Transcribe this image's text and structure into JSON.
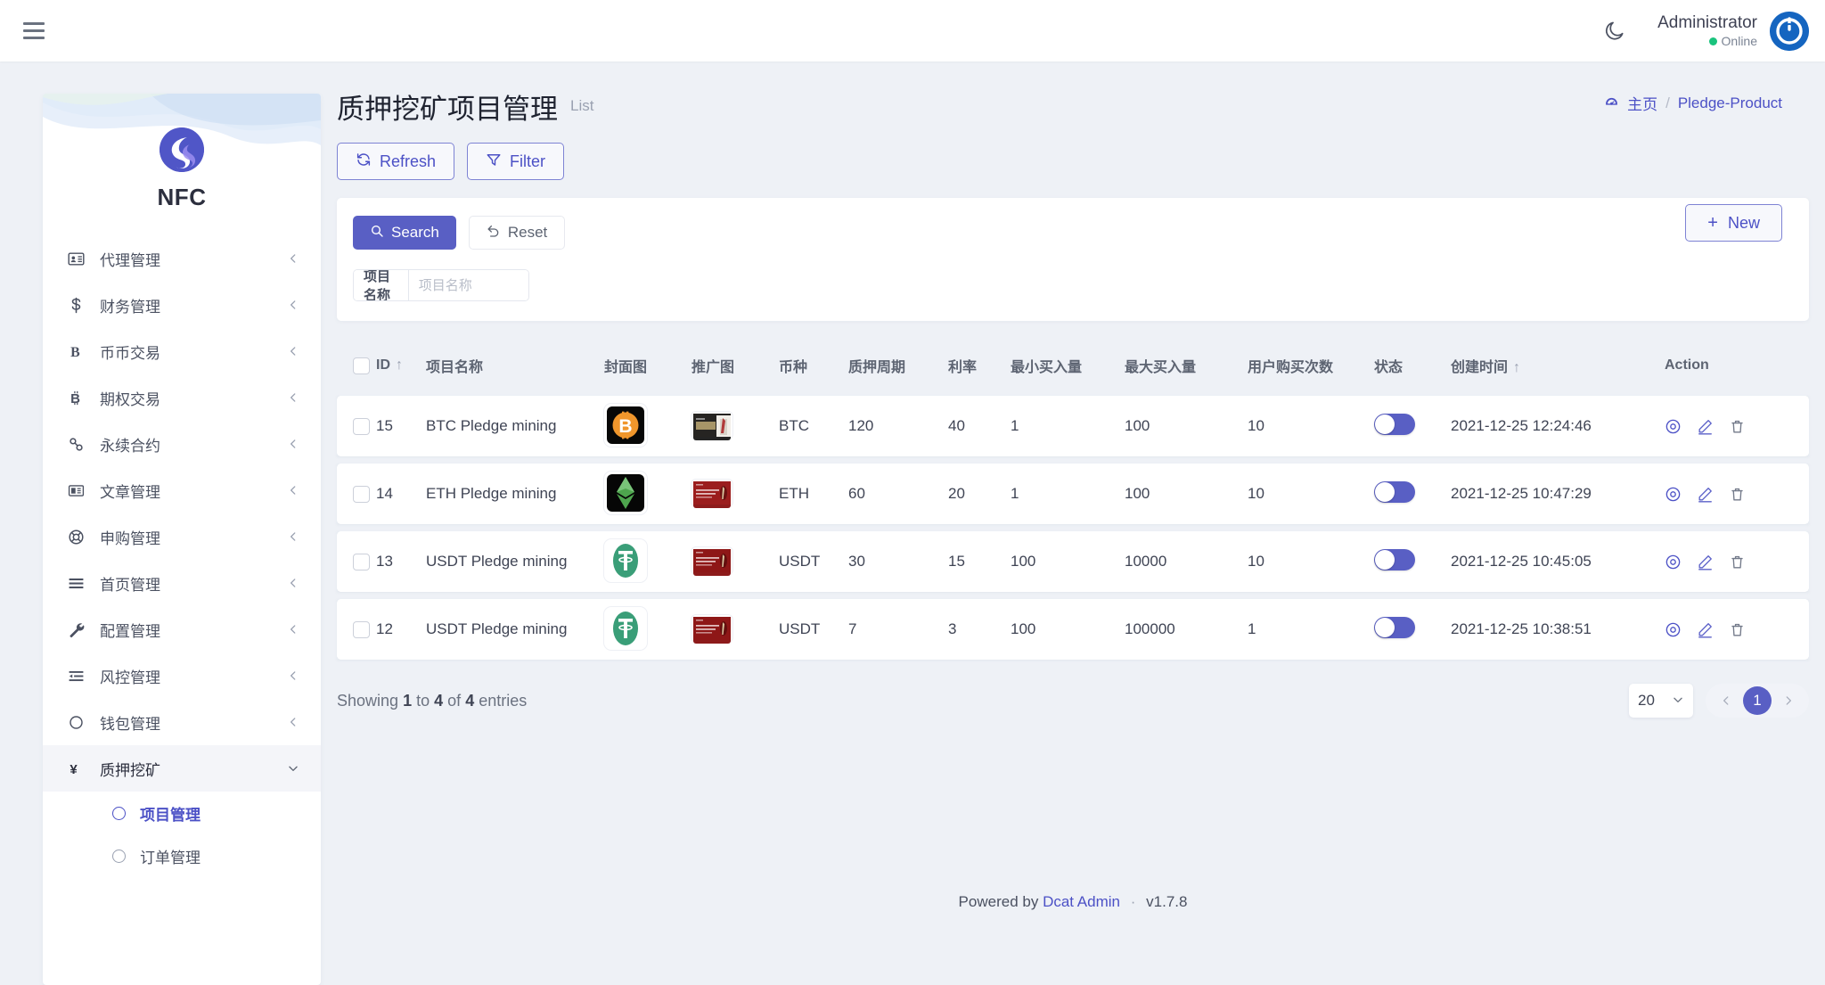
{
  "colors": {
    "accent": "#4c51c6",
    "primary": "#595fc4",
    "page_bg": "#eef1f6",
    "online": "#19c37d",
    "avatar_bg": "#1565c0"
  },
  "topbar": {
    "menu_icon": "hamburger-icon",
    "theme_icon": "moon-icon",
    "user_name": "Administrator",
    "user_status": "Online",
    "avatar_icon": "user-avatar"
  },
  "sidebar": {
    "brand": "NFC",
    "items": [
      {
        "label": "代理管理",
        "icon": "contact-card-icon",
        "arrow": "chevron-left-icon"
      },
      {
        "label": "财务管理",
        "icon": "dollar-icon",
        "arrow": "chevron-left-icon"
      },
      {
        "label": "币币交易",
        "icon": "letter-b-icon",
        "arrow": "chevron-left-icon"
      },
      {
        "label": "期权交易",
        "icon": "bitcoin-icon",
        "arrow": "chevron-left-icon"
      },
      {
        "label": "永续合约",
        "icon": "link-chain-icon",
        "arrow": "chevron-left-icon"
      },
      {
        "label": "文章管理",
        "icon": "newspaper-icon",
        "arrow": "chevron-left-icon"
      },
      {
        "label": "申购管理",
        "icon": "lifebuoy-icon",
        "arrow": "chevron-left-icon"
      },
      {
        "label": "首页管理",
        "icon": "lines-icon",
        "arrow": "chevron-left-icon"
      },
      {
        "label": "配置管理",
        "icon": "wrench-icon",
        "arrow": "chevron-left-icon"
      },
      {
        "label": "风控管理",
        "icon": "indent-icon",
        "arrow": "chevron-left-icon"
      },
      {
        "label": "钱包管理",
        "icon": "circle-icon",
        "arrow": "chevron-left-icon"
      }
    ],
    "active_group": {
      "label": "质押挖矿",
      "icon": "yen-icon",
      "arrow": "chevron-down-icon"
    },
    "submenu": [
      {
        "label": "项目管理",
        "current": true
      },
      {
        "label": "订单管理",
        "current": false
      }
    ]
  },
  "page": {
    "title": "质押挖矿项目管理",
    "subtitle": "List",
    "breadcrumb": {
      "home_icon": "dashboard-icon",
      "home": "主页",
      "separator": "/",
      "current": "Pledge-Product"
    },
    "toolbar": {
      "refresh_label": "Refresh",
      "refresh_icon": "refresh-icon",
      "filter_label": "Filter",
      "filter_icon": "funnel-icon",
      "new_label": "New",
      "new_icon": "plus-icon"
    }
  },
  "filter": {
    "search_label": "Search",
    "search_icon": "search-icon",
    "reset_label": "Reset",
    "reset_icon": "undo-icon",
    "field_label": "项目名称",
    "field_value": "",
    "field_placeholder": "项目名称"
  },
  "table": {
    "columns": [
      {
        "key": "checkbox",
        "label": "",
        "sort": ""
      },
      {
        "key": "id",
        "label": "ID",
        "sort": "↑"
      },
      {
        "key": "name",
        "label": "项目名称",
        "sort": ""
      },
      {
        "key": "cover",
        "label": "封面图",
        "sort": ""
      },
      {
        "key": "promo",
        "label": "推广图",
        "sort": ""
      },
      {
        "key": "coin",
        "label": "币种",
        "sort": ""
      },
      {
        "key": "period",
        "label": "质押周期",
        "sort": ""
      },
      {
        "key": "rate",
        "label": "利率",
        "sort": ""
      },
      {
        "key": "min_buy",
        "label": "最小买入量",
        "sort": ""
      },
      {
        "key": "max_buy",
        "label": "最大买入量",
        "sort": ""
      },
      {
        "key": "user_times",
        "label": "用户购买次数",
        "sort": ""
      },
      {
        "key": "status",
        "label": "状态",
        "sort": ""
      },
      {
        "key": "created_at",
        "label": "创建时间",
        "sort": "↑"
      },
      {
        "key": "action",
        "label": "Action",
        "sort": ""
      }
    ],
    "rows": [
      {
        "id": "15",
        "name": "BTC Pledge mining",
        "cover_icon": "bitcoin-coin-thumbnail",
        "promo_icon": "dark-bank-card-thumbnail",
        "coin": "BTC",
        "period": "120",
        "rate": "40",
        "min_buy": "1",
        "max_buy": "100",
        "user_times": "10",
        "status_on": true,
        "created_at": "2021-12-25 12:24:46"
      },
      {
        "id": "14",
        "name": "ETH Pledge mining",
        "cover_icon": "ethereum-coin-thumbnail",
        "promo_icon": "red-bank-card-thumbnail",
        "coin": "ETH",
        "period": "60",
        "rate": "20",
        "min_buy": "1",
        "max_buy": "100",
        "user_times": "10",
        "status_on": true,
        "created_at": "2021-12-25 10:47:29"
      },
      {
        "id": "13",
        "name": "USDT Pledge mining",
        "cover_icon": "tether-coin-thumbnail",
        "promo_icon": "red-bank-card-thumbnail",
        "coin": "USDT",
        "period": "30",
        "rate": "15",
        "min_buy": "100",
        "max_buy": "10000",
        "user_times": "10",
        "status_on": true,
        "created_at": "2021-12-25 10:45:05"
      },
      {
        "id": "12",
        "name": "USDT Pledge mining",
        "cover_icon": "tether-coin-thumbnail",
        "promo_icon": "red-bank-card-thumbnail",
        "coin": "USDT",
        "period": "7",
        "rate": "3",
        "min_buy": "100",
        "max_buy": "100000",
        "user_times": "1",
        "status_on": true,
        "created_at": "2021-12-25 10:38:51"
      }
    ],
    "row_actions": [
      {
        "name": "view-icon"
      },
      {
        "name": "edit-icon"
      },
      {
        "name": "delete-icon"
      }
    ]
  },
  "pagination": {
    "showing_prefix": "Showing",
    "from": "1",
    "to_word": "to",
    "to": "4",
    "of_word": "of",
    "total": "4",
    "entries_word": "entries",
    "per_page": "20",
    "prev_icon": "chevron-left-icon",
    "next_icon": "chevron-right-icon",
    "current_page": "1"
  },
  "footer": {
    "powered_prefix": "Powered by",
    "brand": "Dcat Admin",
    "dot": "·",
    "version": "v1.7.8"
  }
}
